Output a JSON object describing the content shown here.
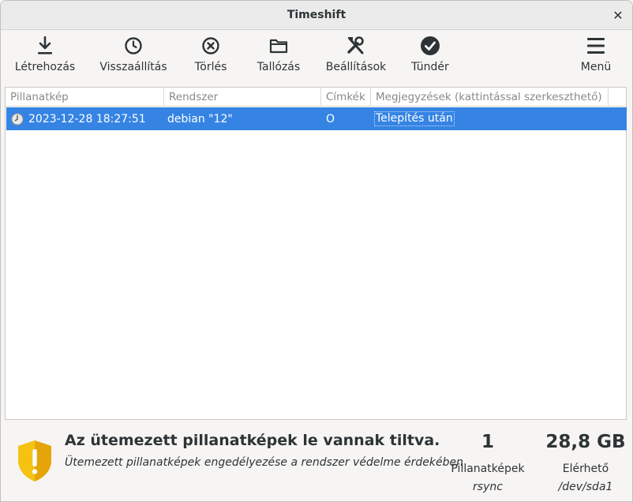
{
  "window": {
    "title": "Timeshift"
  },
  "toolbar": {
    "create": "Létrehozás",
    "restore": "Visszaállítás",
    "delete": "Törlés",
    "browse": "Tallózás",
    "settings": "Beállítások",
    "wizard": "Tündér",
    "menu": "Menü"
  },
  "table": {
    "columns": [
      "Pillanatkép",
      "Rendszer",
      "Címkék",
      "Megjegyzések (kattintással szerkeszthető)"
    ],
    "rows": [
      {
        "snapshot": "2023-12-28 18:27:51",
        "system": "debian \"12\"",
        "tags": "O",
        "note": "Telepítés után"
      }
    ]
  },
  "status": {
    "title": "Az ütemezett pillanatképek le vannak tiltva.",
    "subtitle": "Ütemezett pillanatképek engedélyezése a rendszer védelme érdekében",
    "snapshots_count": "1",
    "snapshots_label": "Pillanatképek",
    "snapshots_mode": "rsync",
    "available_size": "28,8 GB",
    "available_label": "Elérhető",
    "available_device": "/dev/sda1"
  },
  "colors": {
    "selection": "#3584e4",
    "shield": "#f5c211",
    "shield_dark": "#e5a50a"
  }
}
